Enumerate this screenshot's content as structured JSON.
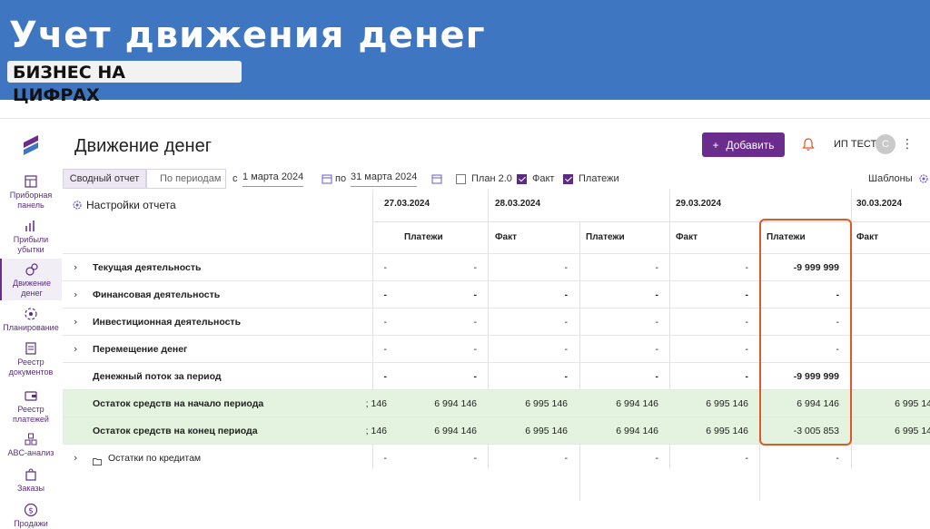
{
  "slide": {
    "title": "Учет движения денег",
    "subtitle": "БИЗНЕС НА ЦИФРАХ"
  },
  "header": {
    "page_title": "Движение денег",
    "add_button": "Добавить",
    "user": "ИП ТЕСТ",
    "avatar_letter": "С"
  },
  "sidebar": {
    "items": [
      {
        "label": "Приборная панель",
        "icon": "dashboard-icon"
      },
      {
        "label": "Прибыли убытки",
        "icon": "chart-icon"
      },
      {
        "label": "Движение денег",
        "icon": "money-icon",
        "active": true
      },
      {
        "label": "Планирование",
        "icon": "target-icon"
      },
      {
        "label": "Реестр документов",
        "icon": "documents-icon"
      },
      {
        "label": "Реестр платежей",
        "icon": "wallet-icon"
      },
      {
        "label": "ABC-анализ",
        "icon": "abc-icon"
      },
      {
        "label": "Заказы",
        "icon": "bag-icon"
      },
      {
        "label": "Продажи",
        "icon": "dollar-icon"
      }
    ]
  },
  "toolbar": {
    "tab_summary": "Сводный отчет",
    "tab_periods": "По периодам",
    "from_label": "с",
    "date_from": "1 марта 2024",
    "to_label": "по",
    "date_to": "31 марта 2024",
    "plan_label": "План 2.0",
    "fact_label": "Факт",
    "payments_label": "Платежи",
    "templates_label": "Шаблоны",
    "plan_checked": false,
    "fact_checked": true,
    "payments_checked": true
  },
  "table": {
    "settings_label": "Настройки отчета",
    "dates": [
      "27.03.2024",
      "28.03.2024",
      "29.03.2024",
      "30.03.2024"
    ],
    "col_headers": [
      "Платежи",
      "Факт",
      "Платежи",
      "Факт",
      "Платежи",
      "Факт"
    ],
    "rows": [
      {
        "label": "Текущая деятельность",
        "expand": "›",
        "values": [
          "-",
          "-",
          "-",
          "-",
          "-",
          "-9 999 999"
        ],
        "green": false
      },
      {
        "label": "Финансовая деятельность",
        "expand": "›",
        "values": [
          "-",
          "-",
          "-",
          "-",
          "-",
          "-"
        ],
        "green": false
      },
      {
        "label": "Инвестиционная деятельность",
        "expand": "›",
        "values": [
          "-",
          "-",
          "-",
          "-",
          "-",
          "-"
        ],
        "green": false
      },
      {
        "label": "Перемещение денег",
        "expand": "›",
        "values": [
          "-",
          "-",
          "-",
          "-",
          "-",
          "-"
        ],
        "green": false
      },
      {
        "label": "Денежный поток за период",
        "expand": "",
        "values": [
          "-",
          "-",
          "-",
          "-",
          "-",
          "-9 999 999"
        ],
        "green": false
      },
      {
        "label": "Остаток средств на начало периода",
        "expand": "",
        "values": [
          "; 146",
          "6 994 146",
          "6 995 146",
          "6 994 146",
          "6 995 146",
          "6 994 146",
          "6 995 14"
        ],
        "green": true
      },
      {
        "label": "Остаток средств на конец периода",
        "expand": "",
        "values": [
          "; 146",
          "6 994 146",
          "6 995 146",
          "6 994 146",
          "6 995 146",
          "-3 005 853",
          "6 995 14"
        ],
        "green": true
      },
      {
        "label": "Остатки по кредитам",
        "expand": "›",
        "values": [
          "-",
          "-",
          "-",
          "-",
          "-",
          "-"
        ],
        "green": false
      }
    ]
  },
  "colors": {
    "banner": "#3f76c1",
    "accent": "#6a2d8e",
    "highlight": "#e0572a",
    "balance_row": "#e3f3df"
  }
}
